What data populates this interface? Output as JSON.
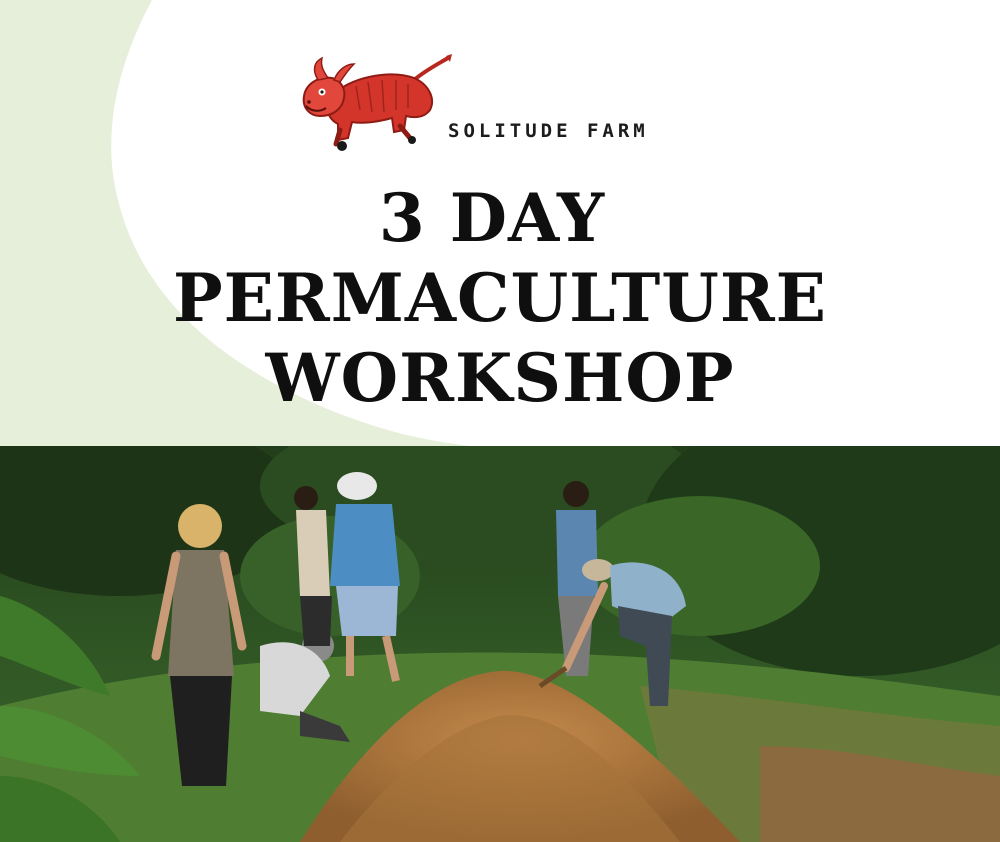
{
  "brand": {
    "name": "SOLITUDE FARM",
    "logo_icon": "red-bull-icon",
    "logo_color": "#d4352b"
  },
  "title": {
    "line1": "3 DAY",
    "line2": "PERMACULTURE",
    "line3": "WORKSHOP"
  },
  "colors": {
    "background": "#ffffff",
    "swoosh": "#e6efd9",
    "title_text": "#0f0f0f",
    "foliage_dark": "#1f3a18",
    "foliage_light": "#5d8f37",
    "soil": "#b07a3f"
  },
  "photo": {
    "icon": "workshop-photo"
  }
}
